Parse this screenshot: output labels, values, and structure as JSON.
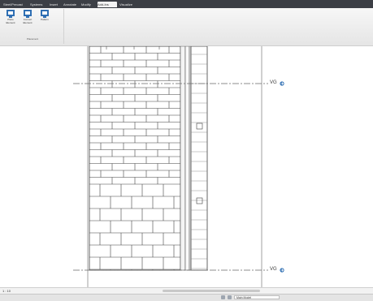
{
  "tabs": [
    {
      "label": "Steel/Precast"
    },
    {
      "label": "Systems"
    },
    {
      "label": "Insert"
    },
    {
      "label": "Annotate"
    },
    {
      "label": "Modify"
    },
    {
      "label": "Add-Ins"
    },
    {
      "label": "Visualize"
    }
  ],
  "ribbon": {
    "panel_title": "Placement",
    "buttons": [
      {
        "label": "Place\nElement",
        "icon": "place-element-icon"
      },
      {
        "label": "Convert\nElement",
        "icon": "convert-element-icon"
      },
      {
        "label": "Pattern\n",
        "icon": "pattern-icon"
      }
    ]
  },
  "levels": [
    {
      "label": "VG",
      "icon": "level-head-icon"
    },
    {
      "label": "VG",
      "icon": "level-head-icon"
    }
  ],
  "status": {
    "view_controls": "1 : 10",
    "model_field": "Main Model"
  },
  "colors": {
    "tabbar": "#3c3f45",
    "ribbon_icon": "#2f6fb3",
    "level_line": "#6a6a6a",
    "brick_line": "#404040"
  }
}
